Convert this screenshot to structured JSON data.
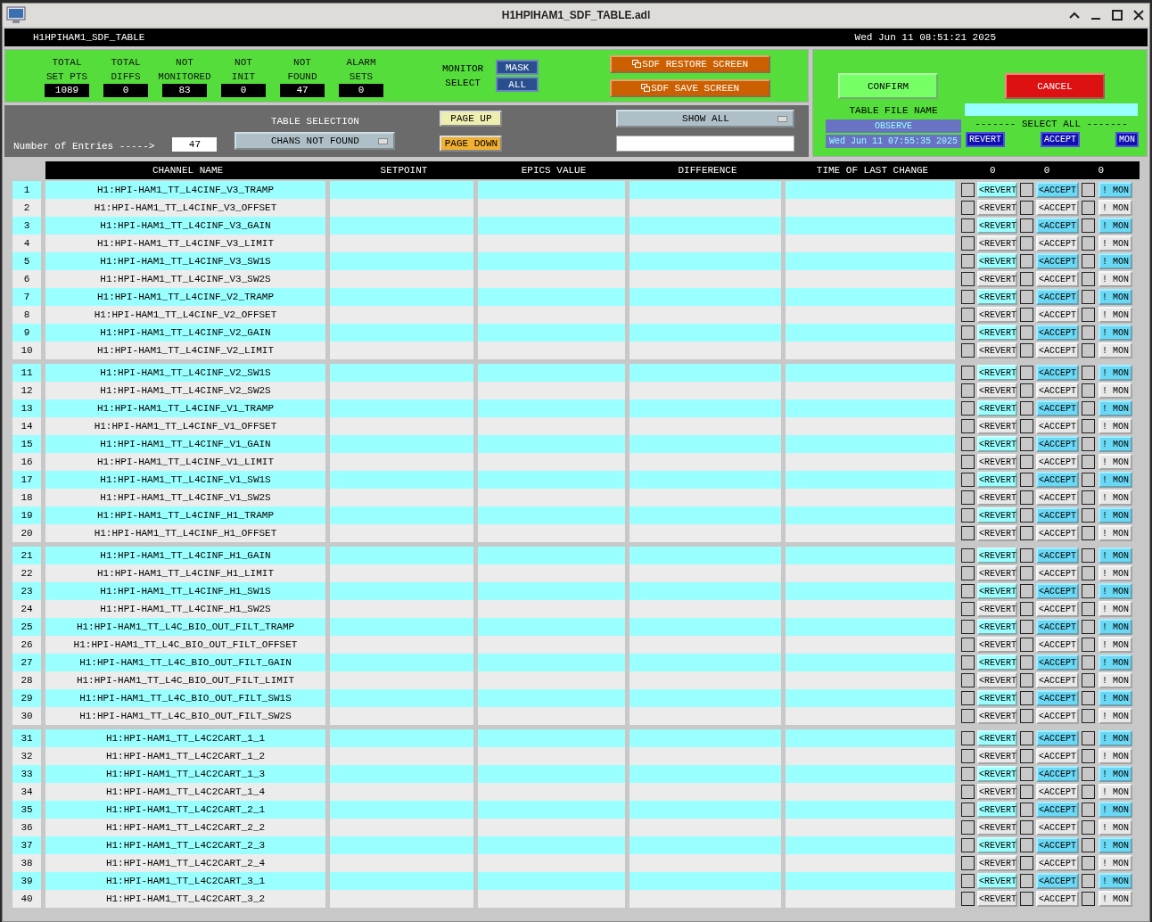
{
  "window": {
    "title": "H1HPIHAM1_SDF_TABLE.adl"
  },
  "header_bar": {
    "screen_name": "H1HPIHAM1_SDF_TABLE",
    "datetime": "Wed Jun 11 08:51:21 2025"
  },
  "stats": [
    {
      "label_lines": [
        "TOTAL",
        "SET PTS"
      ],
      "value": "1089"
    },
    {
      "label_lines": [
        "TOTAL",
        "DIFFS"
      ],
      "value": "0"
    },
    {
      "label_lines": [
        "NOT",
        "MONITORED"
      ],
      "value": "83"
    },
    {
      "label_lines": [
        "NOT",
        "INIT"
      ],
      "value": "0"
    },
    {
      "label_lines": [
        "NOT",
        "FOUND"
      ],
      "value": "47"
    },
    {
      "label_lines": [
        "ALARM",
        "SETS"
      ],
      "value": "0"
    }
  ],
  "monitor_select": {
    "label_lines": [
      "MONITOR",
      "SELECT"
    ],
    "buttons": [
      "MASK",
      "ALL"
    ]
  },
  "sdf_buttons": [
    "SDF RESTORE SCREEN",
    "SDF SAVE SCREEN"
  ],
  "table_selection": {
    "label": "TABLE SELECTION",
    "entries_label": "Number of Entries ----->",
    "entries": "47",
    "menu": "CHANS NOT FOUND"
  },
  "paging": [
    {
      "label": "PAGE UP",
      "kind": "up"
    },
    {
      "label": "PAGE DOWN",
      "kind": "down"
    }
  ],
  "filter": {
    "menu": "SHOW ALL"
  },
  "file_panel": {
    "confirm": "CONFIRM",
    "cancel": "CANCEL",
    "file_name_label": "TABLE FILE NAME",
    "file_name": "OBSERVE",
    "file_time": "Wed Jun 11 07:55:35 2025",
    "select_all_label": "------- SELECT ALL -------",
    "select_all_buttons": [
      "REVERT",
      "ACCEPT",
      "MON"
    ]
  },
  "table": {
    "columns": [
      "CHANNEL NAME",
      "SETPOINT",
      "EPICS VALUE",
      "DIFFERENCE",
      "TIME OF LAST CHANGE"
    ],
    "counts": [
      "0",
      "0",
      "0"
    ],
    "rows": [
      {
        "index": "1",
        "channel": "H1:HPI-HAM1_TT_L4CINF_V3_TRAMP",
        "highlighted": true,
        "buttons": [
          "<REVERT",
          "<ACCEPT",
          "! MON"
        ]
      },
      {
        "index": "2",
        "channel": "H1:HPI-HAM1_TT_L4CINF_V3_OFFSET",
        "highlighted": false,
        "buttons": [
          "<REVERT",
          "<ACCEPT",
          "! MON"
        ]
      },
      {
        "index": "3",
        "channel": "H1:HPI-HAM1_TT_L4CINF_V3_GAIN",
        "highlighted": true,
        "buttons": [
          "<REVERT",
          "<ACCEPT",
          "! MON"
        ]
      },
      {
        "index": "4",
        "channel": "H1:HPI-HAM1_TT_L4CINF_V3_LIMIT",
        "highlighted": false,
        "buttons": [
          "<REVERT",
          "<ACCEPT",
          "! MON"
        ]
      },
      {
        "index": "5",
        "channel": "H1:HPI-HAM1_TT_L4CINF_V3_SW1S",
        "highlighted": true,
        "buttons": [
          "<REVERT",
          "<ACCEPT",
          "! MON"
        ]
      },
      {
        "index": "6",
        "channel": "H1:HPI-HAM1_TT_L4CINF_V3_SW2S",
        "highlighted": false,
        "buttons": [
          "<REVERT",
          "<ACCEPT",
          "! MON"
        ]
      },
      {
        "index": "7",
        "channel": "H1:HPI-HAM1_TT_L4CINF_V2_TRAMP",
        "highlighted": true,
        "buttons": [
          "<REVERT",
          "<ACCEPT",
          "! MON"
        ]
      },
      {
        "index": "8",
        "channel": "H1:HPI-HAM1_TT_L4CINF_V2_OFFSET",
        "highlighted": false,
        "buttons": [
          "<REVERT",
          "<ACCEPT",
          "! MON"
        ]
      },
      {
        "index": "9",
        "channel": "H1:HPI-HAM1_TT_L4CINF_V2_GAIN",
        "highlighted": true,
        "buttons": [
          "<REVERT",
          "<ACCEPT",
          "! MON"
        ]
      },
      {
        "index": "10",
        "channel": "H1:HPI-HAM1_TT_L4CINF_V2_LIMIT",
        "highlighted": false,
        "buttons": [
          "<REVERT",
          "<ACCEPT",
          "! MON"
        ]
      },
      {
        "index": "11",
        "channel": "H1:HPI-HAM1_TT_L4CINF_V2_SW1S",
        "highlighted": true,
        "buttons": [
          "<REVERT",
          "<ACCEPT",
          "! MON"
        ]
      },
      {
        "index": "12",
        "channel": "H1:HPI-HAM1_TT_L4CINF_V2_SW2S",
        "highlighted": false,
        "buttons": [
          "<REVERT",
          "<ACCEPT",
          "! MON"
        ]
      },
      {
        "index": "13",
        "channel": "H1:HPI-HAM1_TT_L4CINF_V1_TRAMP",
        "highlighted": true,
        "buttons": [
          "<REVERT",
          "<ACCEPT",
          "! MON"
        ]
      },
      {
        "index": "14",
        "channel": "H1:HPI-HAM1_TT_L4CINF_V1_OFFSET",
        "highlighted": false,
        "buttons": [
          "<REVERT",
          "<ACCEPT",
          "! MON"
        ]
      },
      {
        "index": "15",
        "channel": "H1:HPI-HAM1_TT_L4CINF_V1_GAIN",
        "highlighted": true,
        "buttons": [
          "<REVERT",
          "<ACCEPT",
          "! MON"
        ]
      },
      {
        "index": "16",
        "channel": "H1:HPI-HAM1_TT_L4CINF_V1_LIMIT",
        "highlighted": false,
        "buttons": [
          "<REVERT",
          "<ACCEPT",
          "! MON"
        ]
      },
      {
        "index": "17",
        "channel": "H1:HPI-HAM1_TT_L4CINF_V1_SW1S",
        "highlighted": true,
        "buttons": [
          "<REVERT",
          "<ACCEPT",
          "! MON"
        ]
      },
      {
        "index": "18",
        "channel": "H1:HPI-HAM1_TT_L4CINF_V1_SW2S",
        "highlighted": false,
        "buttons": [
          "<REVERT",
          "<ACCEPT",
          "! MON"
        ]
      },
      {
        "index": "19",
        "channel": "H1:HPI-HAM1_TT_L4CINF_H1_TRAMP",
        "highlighted": true,
        "buttons": [
          "<REVERT",
          "<ACCEPT",
          "! MON"
        ]
      },
      {
        "index": "20",
        "channel": "H1:HPI-HAM1_TT_L4CINF_H1_OFFSET",
        "highlighted": false,
        "buttons": [
          "<REVERT",
          "<ACCEPT",
          "! MON"
        ]
      },
      {
        "index": "21",
        "channel": "H1:HPI-HAM1_TT_L4CINF_H1_GAIN",
        "highlighted": true,
        "buttons": [
          "<REVERT",
          "<ACCEPT",
          "! MON"
        ]
      },
      {
        "index": "22",
        "channel": "H1:HPI-HAM1_TT_L4CINF_H1_LIMIT",
        "highlighted": false,
        "buttons": [
          "<REVERT",
          "<ACCEPT",
          "! MON"
        ]
      },
      {
        "index": "23",
        "channel": "H1:HPI-HAM1_TT_L4CINF_H1_SW1S",
        "highlighted": true,
        "buttons": [
          "<REVERT",
          "<ACCEPT",
          "! MON"
        ]
      },
      {
        "index": "24",
        "channel": "H1:HPI-HAM1_TT_L4CINF_H1_SW2S",
        "highlighted": false,
        "buttons": [
          "<REVERT",
          "<ACCEPT",
          "! MON"
        ]
      },
      {
        "index": "25",
        "channel": "H1:HPI-HAM1_TT_L4C_BIO_OUT_FILT_TRAMP",
        "highlighted": true,
        "buttons": [
          "<REVERT",
          "<ACCEPT",
          "! MON"
        ]
      },
      {
        "index": "26",
        "channel": "H1:HPI-HAM1_TT_L4C_BIO_OUT_FILT_OFFSET",
        "highlighted": false,
        "buttons": [
          "<REVERT",
          "<ACCEPT",
          "! MON"
        ]
      },
      {
        "index": "27",
        "channel": "H1:HPI-HAM1_TT_L4C_BIO_OUT_FILT_GAIN",
        "highlighted": true,
        "buttons": [
          "<REVERT",
          "<ACCEPT",
          "! MON"
        ]
      },
      {
        "index": "28",
        "channel": "H1:HPI-HAM1_TT_L4C_BIO_OUT_FILT_LIMIT",
        "highlighted": false,
        "buttons": [
          "<REVERT",
          "<ACCEPT",
          "! MON"
        ]
      },
      {
        "index": "29",
        "channel": "H1:HPI-HAM1_TT_L4C_BIO_OUT_FILT_SW1S",
        "highlighted": true,
        "buttons": [
          "<REVERT",
          "<ACCEPT",
          "! MON"
        ]
      },
      {
        "index": "30",
        "channel": "H1:HPI-HAM1_TT_L4C_BIO_OUT_FILT_SW2S",
        "highlighted": false,
        "buttons": [
          "<REVERT",
          "<ACCEPT",
          "! MON"
        ]
      },
      {
        "index": "31",
        "channel": "H1:HPI-HAM1_TT_L4C2CART_1_1",
        "highlighted": true,
        "buttons": [
          "<REVERT",
          "<ACCEPT",
          "! MON"
        ]
      },
      {
        "index": "32",
        "channel": "H1:HPI-HAM1_TT_L4C2CART_1_2",
        "highlighted": false,
        "buttons": [
          "<REVERT",
          "<ACCEPT",
          "! MON"
        ]
      },
      {
        "index": "33",
        "channel": "H1:HPI-HAM1_TT_L4C2CART_1_3",
        "highlighted": true,
        "buttons": [
          "<REVERT",
          "<ACCEPT",
          "! MON"
        ]
      },
      {
        "index": "34",
        "channel": "H1:HPI-HAM1_TT_L4C2CART_1_4",
        "highlighted": false,
        "buttons": [
          "<REVERT",
          "<ACCEPT",
          "! MON"
        ]
      },
      {
        "index": "35",
        "channel": "H1:HPI-HAM1_TT_L4C2CART_2_1",
        "highlighted": true,
        "buttons": [
          "<REVERT",
          "<ACCEPT",
          "! MON"
        ]
      },
      {
        "index": "36",
        "channel": "H1:HPI-HAM1_TT_L4C2CART_2_2",
        "highlighted": false,
        "buttons": [
          "<REVERT",
          "<ACCEPT",
          "! MON"
        ]
      },
      {
        "index": "37",
        "channel": "H1:HPI-HAM1_TT_L4C2CART_2_3",
        "highlighted": true,
        "buttons": [
          "<REVERT",
          "<ACCEPT",
          "! MON"
        ]
      },
      {
        "index": "38",
        "channel": "H1:HPI-HAM1_TT_L4C2CART_2_4",
        "highlighted": false,
        "buttons": [
          "<REVERT",
          "<ACCEPT",
          "! MON"
        ]
      },
      {
        "index": "39",
        "channel": "H1:HPI-HAM1_TT_L4C2CART_3_1",
        "highlighted": true,
        "buttons": [
          "<REVERT",
          "<ACCEPT",
          "! MON"
        ]
      },
      {
        "index": "40",
        "channel": "H1:HPI-HAM1_TT_L4C2CART_3_2",
        "highlighted": false,
        "buttons": [
          "<REVERT",
          "<ACCEPT",
          "! MON"
        ]
      }
    ]
  }
}
